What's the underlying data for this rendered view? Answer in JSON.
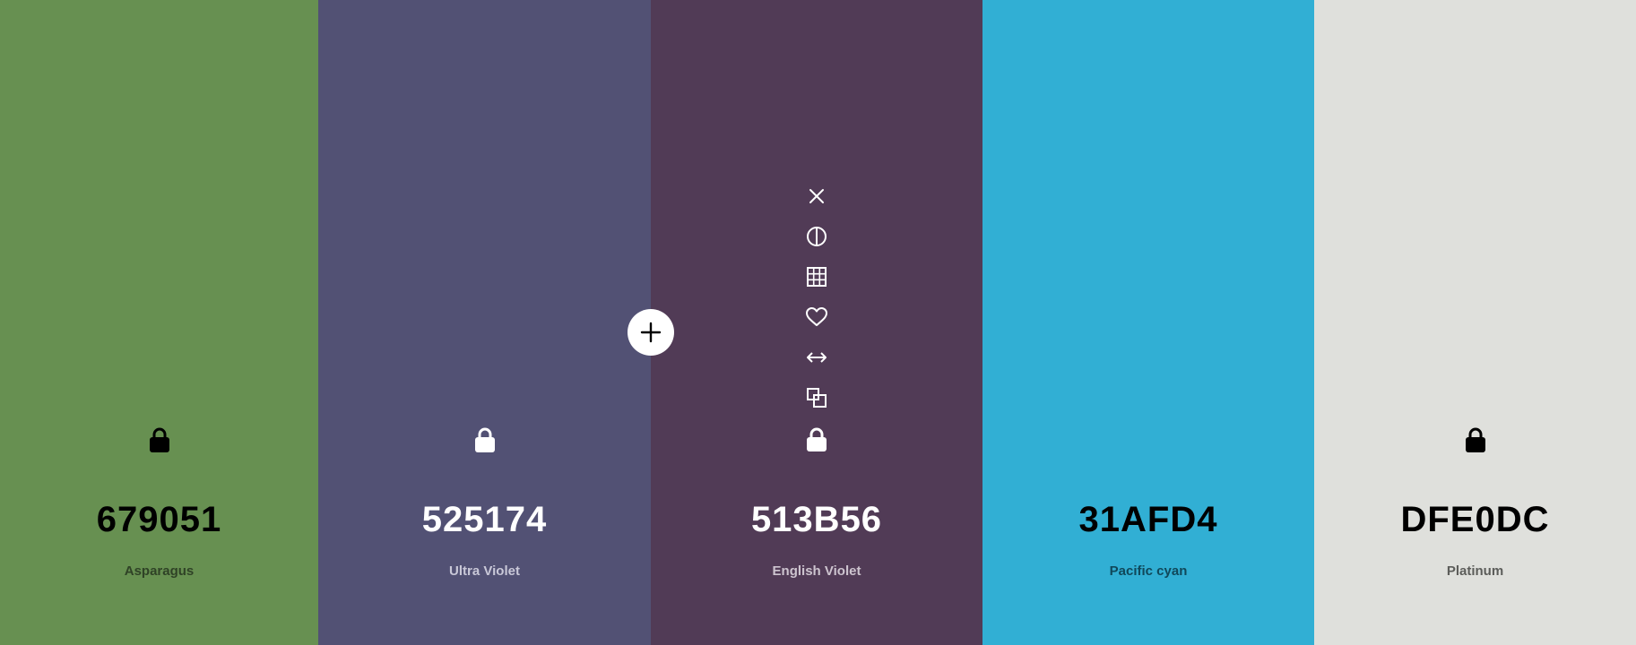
{
  "swatches": [
    {
      "hex": "679051",
      "name": "Asparagus",
      "bg": "#679051",
      "text_color": "#000000",
      "name_color": "#2f4226",
      "locked_icon_visible": true
    },
    {
      "hex": "525174",
      "name": "Ultra Violet",
      "bg": "#525174",
      "text_color": "#ffffff",
      "name_color": "#c9c8d8",
      "locked_icon_visible": true
    },
    {
      "hex": "513B56",
      "name": "English Violet",
      "bg": "#513B56",
      "text_color": "#ffffff",
      "name_color": "#cdc4cf",
      "locked_icon_visible": true
    },
    {
      "hex": "31AFD4",
      "name": "Pacific cyan",
      "bg": "#31AFD4",
      "text_color": "#000000",
      "name_color": "#10485a",
      "locked_icon_visible": false
    },
    {
      "hex": "DFE0DC",
      "name": "Platinum",
      "bg": "#DFE0DC",
      "text_color": "#000000",
      "name_color": "#5c5d5a",
      "locked_icon_visible": true
    }
  ],
  "hover_tools": {
    "icons": [
      "close-icon",
      "contrast-icon",
      "shades-grid-icon",
      "heart-icon",
      "drag-arrows-icon",
      "copy-icon",
      "lock-icon"
    ]
  },
  "add_button": {
    "icon": "plus-icon"
  }
}
